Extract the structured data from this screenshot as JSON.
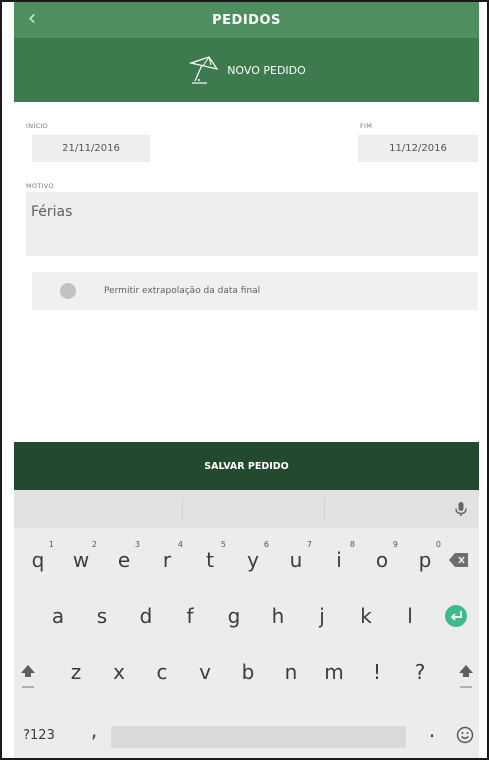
{
  "header": {
    "title": "PEDIDOS",
    "back_icon": "chevron-left-icon"
  },
  "subheader": {
    "icon": "beach-umbrella-icon",
    "label": "NOVO PEDIDO"
  },
  "form": {
    "inicio_label": "INÍCIO",
    "inicio_value": "21/11/2016",
    "fim_label": "FIM",
    "fim_value": "11/12/2016",
    "motivo_label": "MOTIVO",
    "motivo_value": "Férias",
    "toggle_label": "Permitir extrapolação da data final",
    "toggle_on": false
  },
  "save_button": "SALVAR PEDIDO",
  "keyboard": {
    "row1": [
      {
        "ch": "q",
        "num": "1"
      },
      {
        "ch": "w",
        "num": "2"
      },
      {
        "ch": "e",
        "num": "3"
      },
      {
        "ch": "r",
        "num": "4"
      },
      {
        "ch": "t",
        "num": "5"
      },
      {
        "ch": "y",
        "num": "6"
      },
      {
        "ch": "u",
        "num": "7"
      },
      {
        "ch": "i",
        "num": "8"
      },
      {
        "ch": "o",
        "num": "9"
      },
      {
        "ch": "p",
        "num": "0"
      }
    ],
    "row2": [
      "a",
      "s",
      "d",
      "f",
      "g",
      "h",
      "j",
      "k",
      "l"
    ],
    "row3": [
      "z",
      "x",
      "c",
      "v",
      "b",
      "n",
      "m",
      "!",
      "?"
    ],
    "symbols_key": "?123",
    "comma_key": ",",
    "period_key": ".",
    "colors": {
      "enter_key": "#3dbb8a"
    }
  },
  "colors": {
    "header": "#4f8f5f",
    "subheader": "#3d7a4d",
    "save_bar": "#234a2e"
  }
}
